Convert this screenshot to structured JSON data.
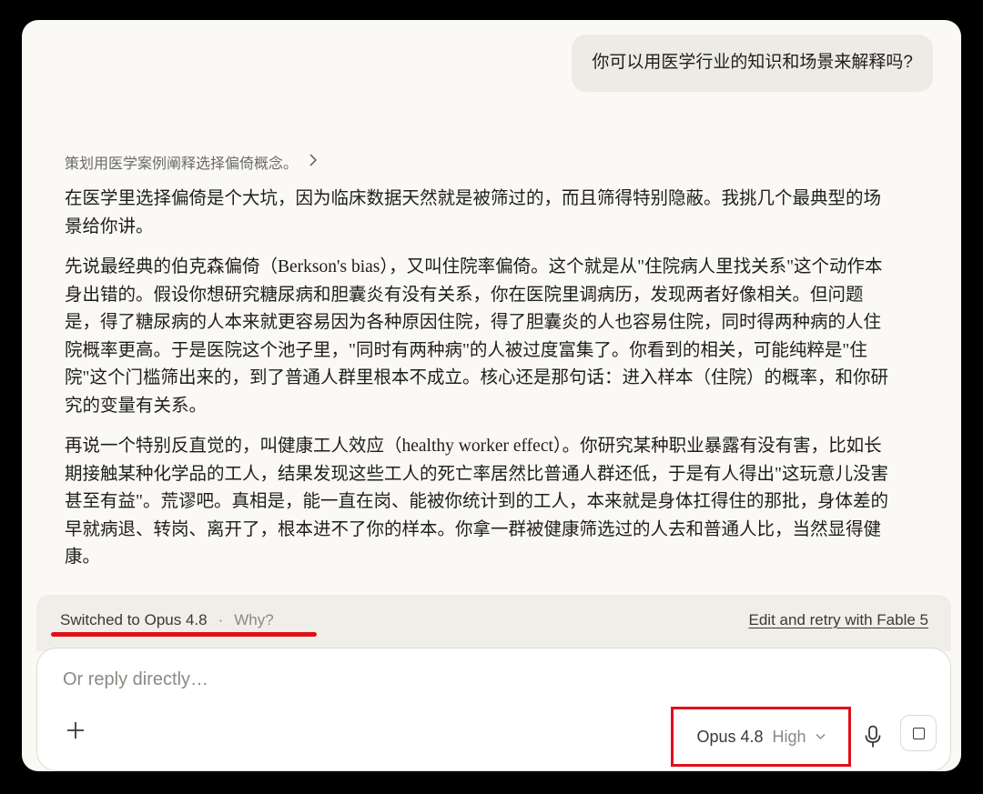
{
  "conversation": {
    "user_message": "你可以用医学行业的知识和场景来解释吗?",
    "thinking_summary": "策划用医学案例阐释选择偏倚概念。",
    "response_paragraphs": [
      "在医学里选择偏倚是个大坑，因为临床数据天然就是被筛过的，而且筛得特别隐蔽。我挑几个最典型的场景给你讲。",
      "先说最经典的伯克森偏倚（Berkson's bias），又叫住院率偏倚。这个就是从\"住院病人里找关系\"这个动作本身出错的。假设你想研究糖尿病和胆囊炎有没有关系，你在医院里调病历，发现两者好像相关。但问题是，得了糖尿病的人本来就更容易因为各种原因住院，得了胆囊炎的人也容易住院，同时得两种病的人住院概率更高。于是医院这个池子里，\"同时有两种病\"的人被过度富集了。你看到的相关，可能纯粹是\"住院\"这个门槛筛出来的，到了普通人群里根本不成立。核心还是那句话：进入样本（住院）的概率，和你研究的变量有关系。",
      "再说一个特别反直觉的，叫健康工人效应（healthy worker effect）。你研究某种职业暴露有没有害，比如长期接触某种化学品的工人，结果发现这些工人的死亡率居然比普通人群还低，于是有人得出\"这玩意儿没害甚至有益\"。荒谬吧。真相是，能一直在岗、能被你统计到的工人，本来就是身体扛得住的那批，身体差的早就病退、转岗、离开了，根本进不了你的样本。你拿一群被健康筛选过的人去和普通人比，当然显得健康。"
    ]
  },
  "switch_notice": {
    "label": "Switched to Opus 4.8",
    "separator": "·",
    "why_label": "Why?",
    "retry_label": "Edit and retry with Fable 5"
  },
  "composer": {
    "placeholder": "Or reply directly…",
    "model_name": "Opus 4.8",
    "effort_level": "High"
  },
  "icons": {
    "thinking_chevron": "chevron-right-icon",
    "add": "plus-icon",
    "model_chevron": "chevron-down-icon",
    "mic": "microphone-icon",
    "stop": "stop-icon"
  },
  "colors": {
    "annotation_red": "#e0101a",
    "page_background": "#faf9f6",
    "text_primary": "#1f1e1b"
  }
}
